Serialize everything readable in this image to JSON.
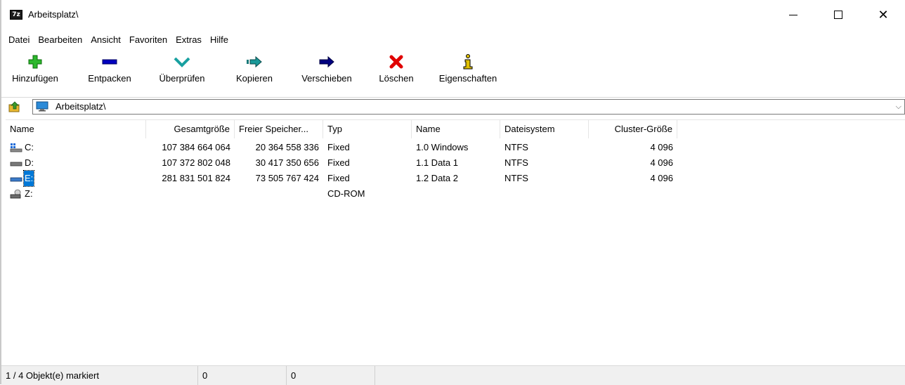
{
  "window": {
    "title": "Arbeitsplatz\\",
    "app_icon_text": "7z"
  },
  "menu": [
    "Datei",
    "Bearbeiten",
    "Ansicht",
    "Favoriten",
    "Extras",
    "Hilfe"
  ],
  "toolbar": [
    {
      "label": "Hinzufügen",
      "icon": "add-icon",
      "color": "#2db82d"
    },
    {
      "label": "Entpacken",
      "icon": "extract-icon",
      "color": "#0000c0"
    },
    {
      "label": "Überprüfen",
      "icon": "test-icon",
      "color": "#18a0a0"
    },
    {
      "label": "Kopieren",
      "icon": "copy-icon",
      "color": "#1a7a7a"
    },
    {
      "label": "Verschieben",
      "icon": "move-icon",
      "color": "#000080"
    },
    {
      "label": "Löschen",
      "icon": "delete-icon",
      "color": "#e00000"
    },
    {
      "label": "Eigenschaften",
      "icon": "info-icon",
      "color": "#e0c000"
    }
  ],
  "address": {
    "path": "Arbeitsplatz\\"
  },
  "columns": [
    "Name",
    "Gesamtgröße",
    "Freier Speicher...",
    "Typ",
    "Name",
    "Dateisystem",
    "Cluster-Größe"
  ],
  "rows": [
    {
      "name": "C:",
      "total": "107 384 664 064",
      "free": "20 364 558 336",
      "type": "Fixed",
      "label": "1.0 Windows",
      "fs": "NTFS",
      "cluster": "4 096",
      "icon": "system-drive-icon",
      "selected": false
    },
    {
      "name": "D:",
      "total": "107 372 802 048",
      "free": "30 417 350 656",
      "type": "Fixed",
      "label": "1.1 Data 1",
      "fs": "NTFS",
      "cluster": "4 096",
      "icon": "hard-drive-icon",
      "selected": false
    },
    {
      "name": "E:",
      "total": "281 831 501 824",
      "free": "73 505 767 424",
      "type": "Fixed",
      "label": "1.2 Data 2",
      "fs": "NTFS",
      "cluster": "4 096",
      "icon": "hard-drive-icon",
      "selected": true
    },
    {
      "name": "Z:",
      "total": "",
      "free": "",
      "type": "CD-ROM",
      "label": "",
      "fs": "",
      "cluster": "",
      "icon": "cdrom-drive-icon",
      "selected": false
    }
  ],
  "status": {
    "selection": "1 / 4 Objekt(e) markiert",
    "size": "0",
    "packed": "0"
  }
}
